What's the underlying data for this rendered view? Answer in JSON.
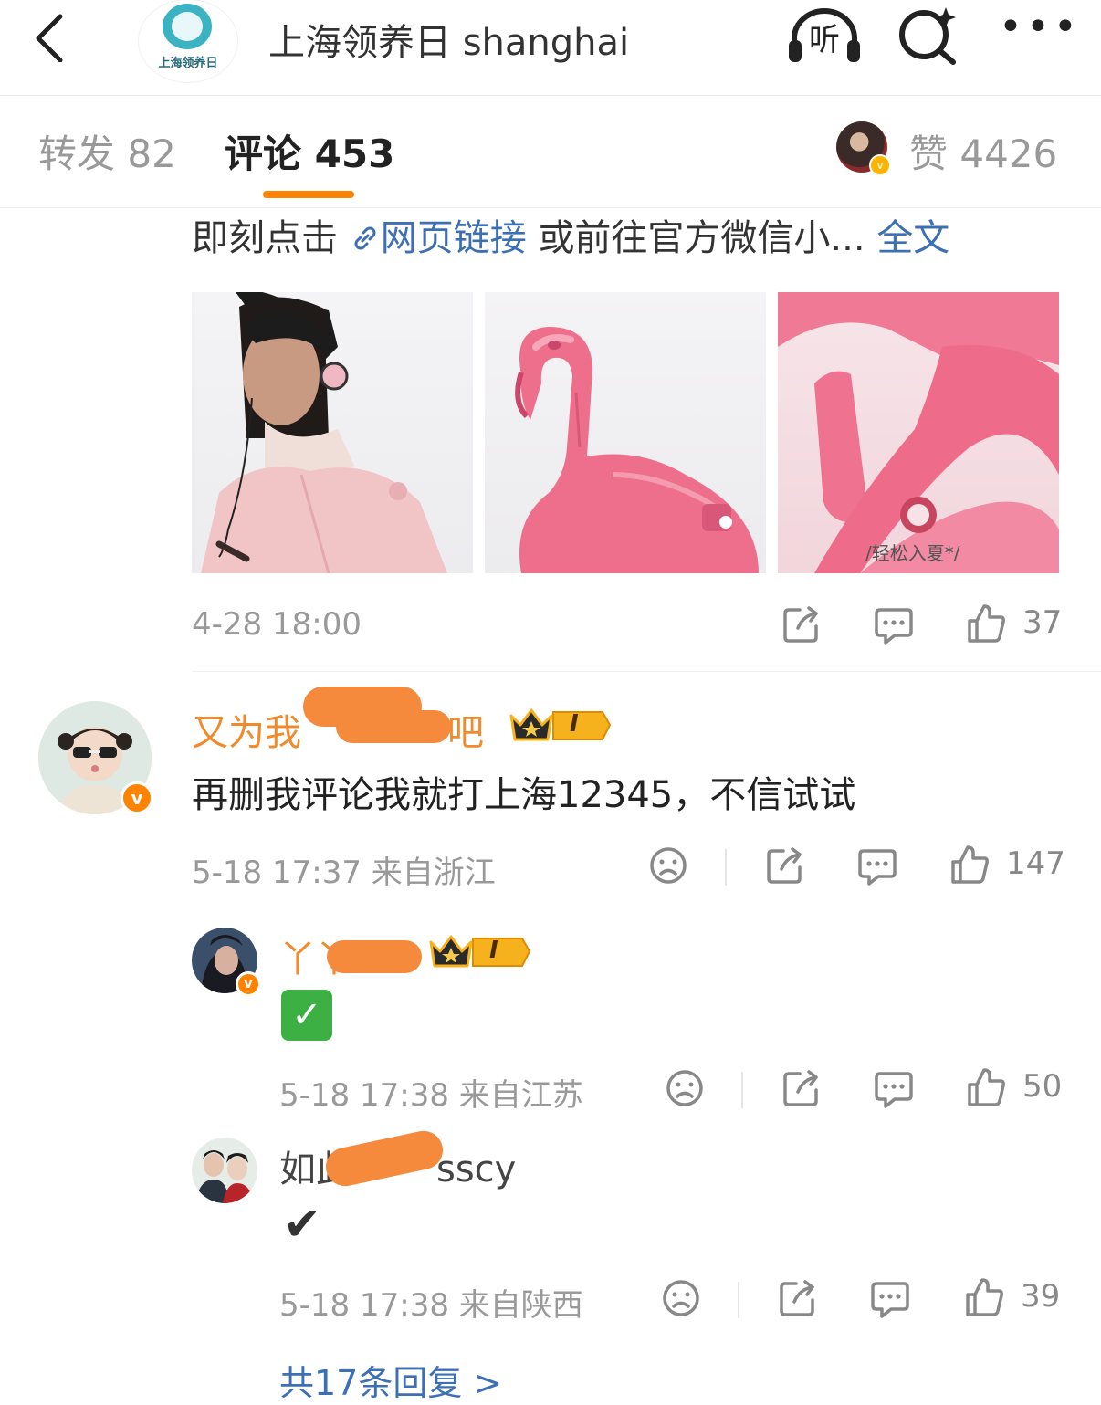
{
  "header": {
    "back_icon": "chevron-left-icon",
    "account_logo_text": "上海领养日",
    "title": "上海领养日 shanghai",
    "listen_label": "听",
    "search_icon": "search-sparkle-icon",
    "more_label": "•••"
  },
  "tabs": {
    "repost": "转发 82",
    "comment": "评论 453",
    "like": "赞 4426",
    "active_color": "#ff8200"
  },
  "post": {
    "text_before": "即刻点击",
    "link_text": "网页链接",
    "text_after": "或前往官方微信小...",
    "full_text_label": "全文",
    "image_caption": "/轻松入夏*/",
    "timestamp": "4-28 18:00",
    "like_count": "37"
  },
  "comments": [
    {
      "username_visible_start": "又为我",
      "username_visible_end": "吧",
      "level": "I",
      "text": "再删我评论我就打上海12345，不信试试",
      "meta": "5-18 17:37  来自浙江",
      "like_count": "147"
    },
    {
      "username_visible_start": "丫丫",
      "level": "I",
      "emoji": "✅",
      "meta": "5-18 17:38  来自江苏",
      "like_count": "50"
    },
    {
      "username_visible_start": "如此",
      "username_visible_end": "sscy",
      "text": "✔",
      "meta": "5-18 17:38  来自陕西",
      "like_count": "39"
    }
  ],
  "more_replies": "共17条回复 >",
  "colors": {
    "username": "#f08a2a",
    "link": "#3d6fb4",
    "verified_badge": "#ff8200"
  }
}
